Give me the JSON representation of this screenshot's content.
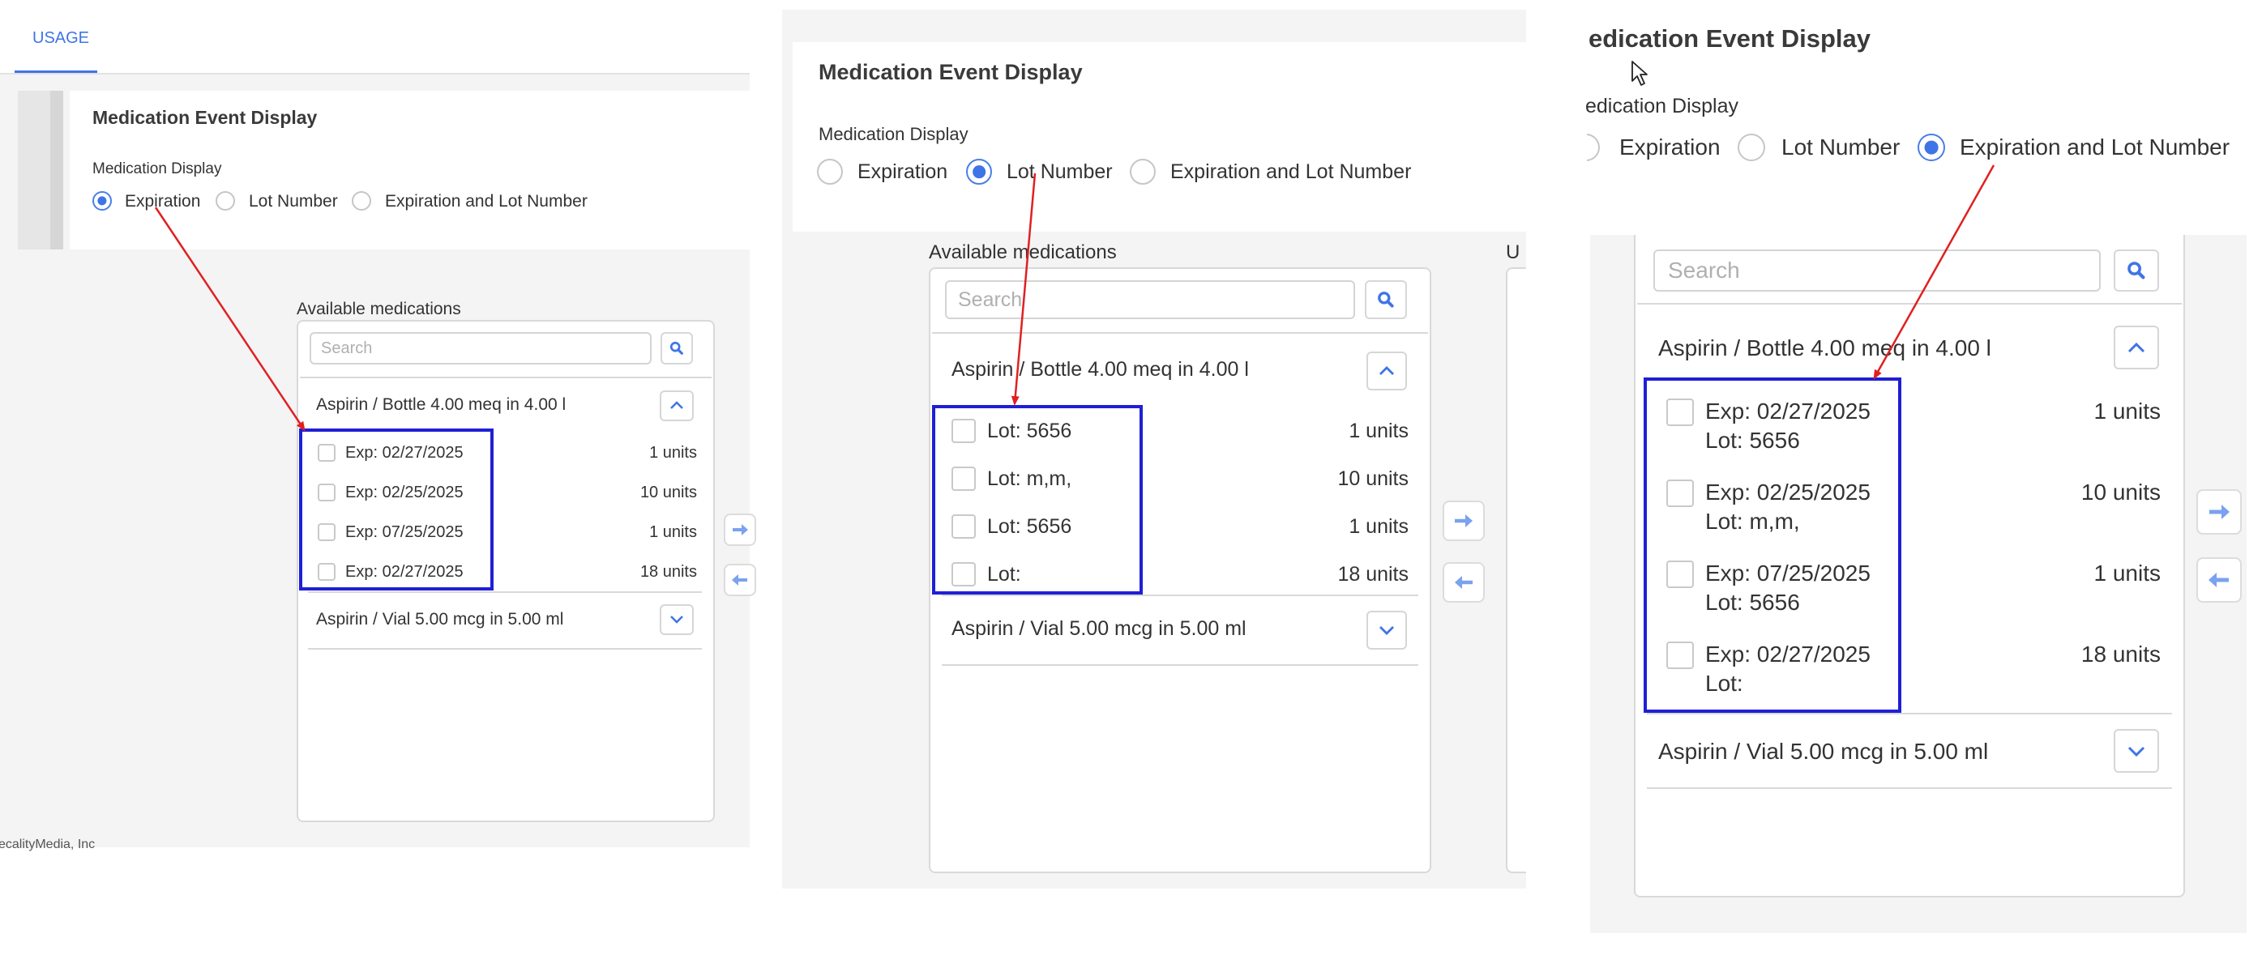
{
  "panel1": {
    "tab_usage": "USAGE",
    "section_title": "Medication Event Display",
    "display_label": "Medication Display",
    "radio_expiration": "Expiration",
    "radio_lot": "Lot Number",
    "radio_both": "Expiration and Lot Number",
    "available_label": "Available medications",
    "search_placeholder": "Search",
    "group1": "Aspirin / Bottle 4.00 meq in 4.00 l",
    "group2": "Aspirin / Vial 5.00 mcg in 5.00 ml",
    "items": [
      {
        "label": "Exp: 02/27/2025",
        "units": "1 units"
      },
      {
        "label": "Exp: 02/25/2025",
        "units": "10 units"
      },
      {
        "label": "Exp: 07/25/2025",
        "units": "1 units"
      },
      {
        "label": "Exp: 02/27/2025",
        "units": "18 units"
      }
    ],
    "footer_text": "ecalityMedia, Inc"
  },
  "panel2": {
    "section_title": "Medication Event Display",
    "display_label": "Medication Display",
    "radio_expiration": "Expiration",
    "radio_lot": "Lot Number",
    "radio_both": "Expiration and Lot Number",
    "available_label": "Available medications",
    "search_placeholder": "Search",
    "group1": "Aspirin / Bottle 4.00 meq in 4.00 l",
    "group2": "Aspirin / Vial 5.00 mcg in 5.00 ml",
    "items": [
      {
        "label": "Lot: 5656",
        "units": "1 units"
      },
      {
        "label": "Lot: m,m,",
        "units": "10 units"
      },
      {
        "label": "Lot: 5656",
        "units": "1 units"
      },
      {
        "label": "Lot:",
        "units": "18 units"
      }
    ],
    "right_cut": "U"
  },
  "panel3": {
    "section_title": "edication Event Display",
    "display_label": "edication Display",
    "radio_expiration": "Expiration",
    "radio_lot": "Lot Number",
    "radio_both": "Expiration and Lot Number",
    "search_placeholder": "Search",
    "group1": "Aspirin / Bottle 4.00 meq in 4.00 l",
    "group2": "Aspirin / Vial 5.00 mcg in 5.00 ml",
    "items": [
      {
        "exp": "Exp: 02/27/2025",
        "lot": "Lot: 5656",
        "units": "1 units"
      },
      {
        "exp": "Exp: 02/25/2025",
        "lot": "Lot: m,m,",
        "units": "10 units"
      },
      {
        "exp": "Exp: 07/25/2025",
        "lot": "Lot: 5656",
        "units": "1 units"
      },
      {
        "exp": "Exp: 02/27/2025",
        "lot": "Lot:",
        "units": "18 units"
      }
    ]
  },
  "icons": {
    "search": "search-icon",
    "chevron_up": "chevron-up-icon",
    "chevron_down": "chevron-down-icon",
    "arrow_right": "arrow-right-icon",
    "arrow_left": "arrow-left-icon",
    "cursor": "mouse-cursor-icon"
  },
  "colors": {
    "accent": "#3f74e6",
    "highlight_box": "#1f1fd6",
    "annotation_arrow": "#e02020"
  }
}
